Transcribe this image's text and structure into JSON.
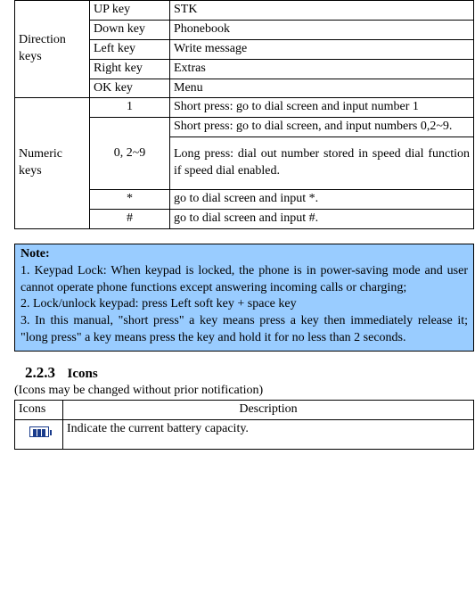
{
  "table1": {
    "direction": {
      "header": "Direction keys",
      "rows": [
        {
          "key": "UP key",
          "fn": "STK"
        },
        {
          "key": "Down key",
          "fn": "Phonebook"
        },
        {
          "key": "Left key",
          "fn": "Write message"
        },
        {
          "key": "Right key",
          "fn": "Extras"
        },
        {
          "key": "OK key",
          "fn": "Menu"
        }
      ]
    },
    "numeric": {
      "header": "Numeric keys",
      "rows": {
        "r1": {
          "key": "1",
          "fn": "Short press: go to dial screen and input number 1"
        },
        "r2": {
          "key": "0, 2~9",
          "fnA": "Short press: go to dial screen, and input numbers 0,2~9.",
          "fnB": "Long press: dial out number stored in speed dial function if speed dial enabled."
        },
        "r3": {
          "key": "*",
          "fn": "go to dial screen and input *."
        },
        "r4": {
          "key": "#",
          "fn": "go to dial screen and input #."
        }
      }
    }
  },
  "note": {
    "title": "Note:",
    "p1": "1. Keypad Lock: When keypad is locked, the phone is in power-saving mode and user cannot operate phone functions except answering incoming calls or charging;",
    "p2": "2. Lock/unlock keypad: press Left soft key + space key",
    "p3": "3. In this manual, \"short press\" a key means press a key then immediately release it; \"long press\" a key means press the key and hold it for no less than 2 seconds."
  },
  "section": {
    "number": "2.2.3",
    "title": "Icons",
    "subtitle": "(Icons may be changed without prior notification)"
  },
  "iconsTable": {
    "h1": "Icons",
    "h2": "Description",
    "rows": [
      {
        "desc": "Indicate the current battery capacity."
      }
    ]
  }
}
